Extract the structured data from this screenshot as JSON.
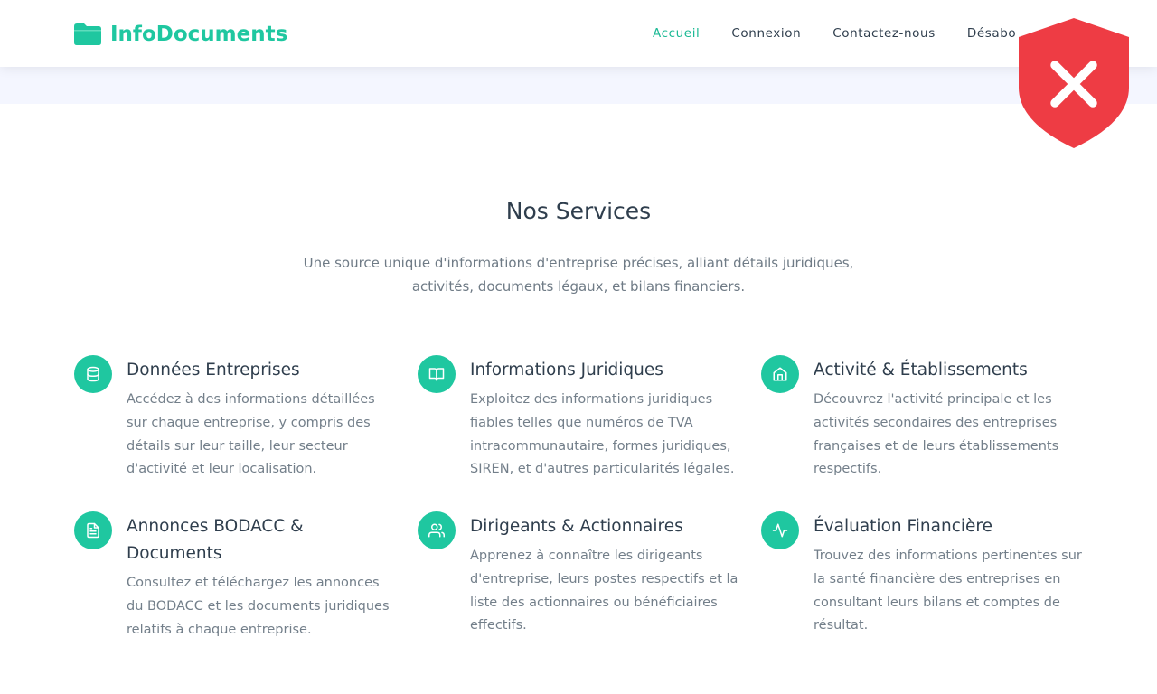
{
  "header": {
    "brand": "InfoDocuments",
    "nav": [
      {
        "label": "Accueil",
        "active": true
      },
      {
        "label": "Connexion",
        "active": false
      },
      {
        "label": "Contactez-nous",
        "active": false
      },
      {
        "label": "Désabo",
        "active": false
      }
    ]
  },
  "services": {
    "title": "Nos Services",
    "subtitle": "Une source unique d'informations d'entreprise précises, alliant détails juridiques, activités, documents légaux, et bilans financiers.",
    "items": [
      {
        "title": "Données Entreprises",
        "description": "Accédez à des informations détaillées sur chaque entreprise, y compris des détails sur leur taille, leur secteur d'activité et leur localisation.",
        "icon": "database-icon"
      },
      {
        "title": "Informations Juridiques",
        "description": "Exploitez des informations juridiques fiables telles que numéros de TVA intracommunautaire, formes juridiques, SIREN, et d'autres particularités légales.",
        "icon": "book-open-icon"
      },
      {
        "title": "Activité & Établissements",
        "description": "Découvrez l'activité principale et les activités secondaires des entreprises françaises et de leurs établissements respectifs.",
        "icon": "home-icon"
      },
      {
        "title": "Annonces BODACC & Documents",
        "description": "Consultez et téléchargez les annonces du BODACC et les documents juridiques relatifs à chaque entreprise.",
        "icon": "file-text-icon"
      },
      {
        "title": "Dirigeants & Actionnaires",
        "description": "Apprenez à connaître les dirigeants d'entreprise, leurs postes respectifs et la liste des actionnaires ou bénéficiaires effectifs.",
        "icon": "users-icon"
      },
      {
        "title": "Évaluation Financière",
        "description": "Trouvez des informations pertinentes sur la santé financière des entreprises en consultant leurs bilans et comptes de résultat.",
        "icon": "activity-icon"
      }
    ]
  },
  "overlay": {
    "icon": "shield-x-icon"
  },
  "colors": {
    "accent": "#1fc7a0",
    "nav_active": "#1bb994",
    "heading": "#2f3e4d",
    "body_text": "#737f8a",
    "band": "#f4f6ff",
    "shield": "#ee3c44"
  }
}
